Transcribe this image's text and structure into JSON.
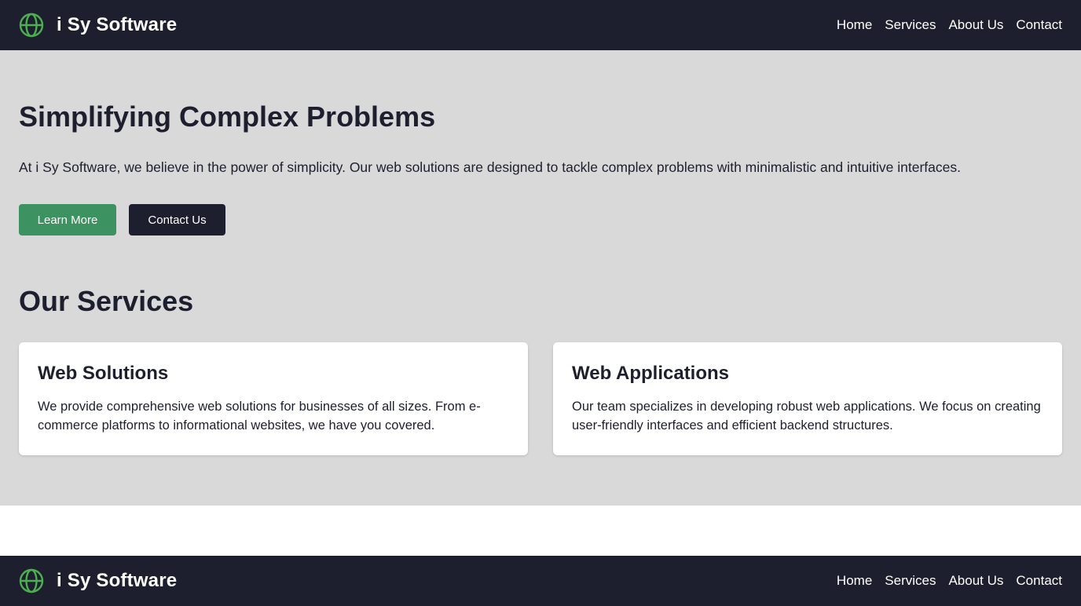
{
  "header": {
    "brand": "i Sy Software",
    "logo_icon": "globe-icon",
    "nav": [
      "Home",
      "Services",
      "About Us",
      "Contact"
    ]
  },
  "hero": {
    "title": "Simplifying Complex Problems",
    "text": "At i Sy Software, we believe in the power of simplicity. Our web solutions are designed to tackle complex problems with minimalistic and intuitive interfaces.",
    "primary_button": "Learn More",
    "secondary_button": "Contact Us"
  },
  "services": {
    "title": "Our Services",
    "cards": [
      {
        "title": "Web Solutions",
        "text": "We provide comprehensive web solutions for businesses of all sizes. From e-commerce platforms to informational websites, we have you covered."
      },
      {
        "title": "Web Applications",
        "text": "Our team specializes in developing robust web applications. We focus on creating user-friendly interfaces and efficient backend structures."
      }
    ]
  },
  "footer": {
    "brand": "i Sy Software",
    "logo_icon": "globe-icon",
    "nav": [
      "Home",
      "Services",
      "About Us",
      "Contact"
    ]
  },
  "colors": {
    "dark": "#1e1f2e",
    "accent_green": "#3c9260",
    "logo_green": "#4caf50",
    "section_bg": "#d9d9d9"
  }
}
